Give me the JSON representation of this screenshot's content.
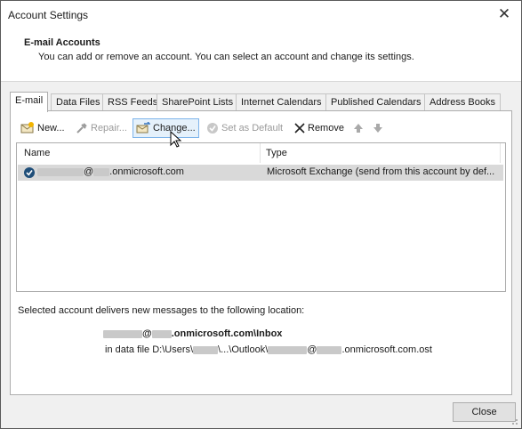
{
  "window": {
    "title": "Account Settings",
    "close_glyph": "✕"
  },
  "header": {
    "title": "E-mail Accounts",
    "description": "You can add or remove an account. You can select an account and change its settings."
  },
  "tabs": [
    {
      "label": "E-mail",
      "active": true
    },
    {
      "label": "Data Files"
    },
    {
      "label": "RSS Feeds"
    },
    {
      "label": "SharePoint Lists"
    },
    {
      "label": "Internet Calendars"
    },
    {
      "label": "Published Calendars"
    },
    {
      "label": "Address Books"
    }
  ],
  "toolbar": {
    "new": "New...",
    "repair": "Repair...",
    "change": "Change...",
    "set_default": "Set as Default",
    "remove": "Remove"
  },
  "list": {
    "columns": [
      "Name",
      "Type"
    ],
    "rows": [
      {
        "name_visible": "@",
        "name_domain": ".onmicrosoft.com",
        "type": "Microsoft Exchange (send from this account by def..."
      }
    ]
  },
  "delivery": {
    "label": "Selected account delivers new messages to the following location:",
    "location_domain": ".onmicrosoft.com\\Inbox",
    "data_file_prefix": "in data file D:\\Users\\",
    "data_file_mid": "\\...\\Outlook\\",
    "data_file_suffix": ".onmicrosoft.com.ost"
  },
  "buttons": {
    "close": "Close"
  },
  "colors": {
    "selected_row": "#d9d9d9",
    "hover_border": "#7eb4ea",
    "hover_fill": "#e5f1fb",
    "check_blue": "#1f4e79"
  }
}
